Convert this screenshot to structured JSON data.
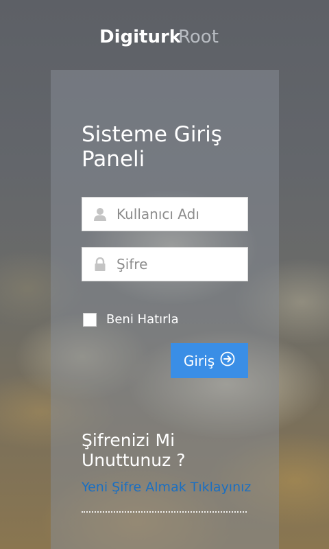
{
  "brand": {
    "logo_text_primary": "Digiturk",
    "logo_text_secondary": "Root"
  },
  "login_panel": {
    "title": "Sisteme Giriş Paneli",
    "username": {
      "placeholder": "Kullanıcı Adı",
      "value": "",
      "icon": "user-icon"
    },
    "password": {
      "placeholder": "Şifre",
      "value": "",
      "icon": "lock-icon"
    },
    "remember_me": {
      "label": "Beni Hatırla",
      "checked": false
    },
    "submit": {
      "label": "Giriş",
      "icon": "arrow-right-circle-icon",
      "color": "#3a8ee6"
    }
  },
  "forgot": {
    "title": "Şifrenizi Mi Unuttunuz ?",
    "link_label": "Yeni Şifre Almak Tıklayınız",
    "link_color": "#1a6fc2"
  }
}
